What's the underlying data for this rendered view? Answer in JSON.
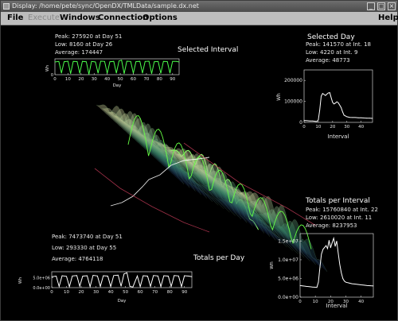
{
  "window": {
    "title": "Display: /home/pete/sync/OpenDX/TMLData/sample.dx.net"
  },
  "menu": {
    "file": "File",
    "execute": "Execute",
    "windows": "Windows",
    "connection": "Connection",
    "options": "Options",
    "help": "Help"
  },
  "selected_interval": {
    "title": "Selected Interval",
    "peak": "Peak: 275920 at Day 51",
    "low": "Low: 8160 at Day 26",
    "average": "Average: 174447",
    "ylabel": "Wh",
    "xlabel": "Day",
    "xticks": [
      "0",
      "10",
      "20",
      "30",
      "40",
      "50",
      "60",
      "70",
      "80",
      "90"
    ],
    "yticks": [
      "0"
    ]
  },
  "selected_day": {
    "title": "Selected Day",
    "peak": "Peak: 141570 at Int. 18",
    "low": "Low: 4220 at Int. 9",
    "average": "Average: 48773",
    "ylabel": "Wh",
    "xlabel": "Interval",
    "yticks": [
      "200000",
      "100000",
      "0"
    ],
    "xticks": [
      "0",
      "10",
      "20",
      "30",
      "40"
    ]
  },
  "totals_per_interval": {
    "title": "Totals per Interval",
    "peak": "Peak: 15760840 at Int. 22",
    "low": "Low: 2610020 at Int. 11",
    "average": "Average: 8237953",
    "ylabel": "Wh",
    "xlabel": "Interval",
    "yticks": [
      "1.5e+07",
      "1.0e+07",
      "5.0e+06",
      "0.0e+00"
    ],
    "xticks": [
      "0",
      "10",
      "20",
      "30",
      "40"
    ]
  },
  "totals_per_day": {
    "title": "Totals per Day",
    "peak": "Peak: 7473740 at Day 51",
    "low": "Low: 293330 at Day 55",
    "average": "Average: 4764118",
    "ylabel": "Wh",
    "xlabel": "Day",
    "yticks": [
      "5.0e+06",
      "0.0e+00"
    ],
    "xticks": [
      "0",
      "10",
      "20",
      "30",
      "40",
      "50",
      "60",
      "70",
      "80",
      "90"
    ]
  },
  "chart_data": [
    {
      "type": "line",
      "title": "Selected Day",
      "xlabel": "Interval",
      "ylabel": "Wh",
      "xlim": [
        0,
        48
      ],
      "ylim": [
        0,
        250000
      ],
      "x": [
        0,
        2,
        4,
        6,
        8,
        9,
        10,
        11,
        12,
        13,
        14,
        15,
        16,
        17,
        18,
        19,
        20,
        21,
        22,
        23,
        24,
        25,
        26,
        27,
        28,
        30,
        32,
        34,
        36,
        38,
        40,
        42,
        44,
        46,
        48
      ],
      "values": [
        9000,
        8000,
        7000,
        6500,
        5000,
        4220,
        12000,
        60000,
        125000,
        138000,
        133000,
        128000,
        135000,
        140000,
        141570,
        118000,
        96000,
        88000,
        92000,
        98000,
        93000,
        82000,
        70000,
        50000,
        34000,
        27000,
        24000,
        23000,
        23000,
        22000,
        22000,
        21000,
        20000,
        20000,
        19000
      ]
    },
    {
      "type": "line",
      "title": "Totals per Interval",
      "xlabel": "Interval",
      "ylabel": "Wh",
      "xlim": [
        0,
        48
      ],
      "ylim": [
        0,
        17000000
      ],
      "x": [
        0,
        2,
        4,
        6,
        8,
        10,
        11,
        12,
        13,
        14,
        15,
        16,
        17,
        18,
        19,
        20,
        21,
        22,
        23,
        24,
        25,
        26,
        27,
        28,
        29,
        30,
        32,
        34,
        36,
        38,
        40,
        42,
        44,
        46,
        48
      ],
      "values": [
        3100000,
        3000000,
        2900000,
        2800000,
        2700000,
        2650000,
        2610020,
        4000000,
        8000000,
        11500000,
        12800000,
        13300000,
        13800000,
        13000000,
        15200000,
        13200000,
        14600000,
        15760840,
        13600000,
        15000000,
        11800000,
        8800000,
        6500000,
        5000000,
        4300000,
        4000000,
        3800000,
        3600000,
        3500000,
        3400000,
        3300000,
        3200000,
        3100000,
        3050000,
        3000000
      ]
    },
    {
      "type": "line",
      "title": "Selected Interval",
      "xlabel": "Day",
      "ylabel": "Wh",
      "xlim": [
        0,
        95
      ],
      "x": [
        0,
        3,
        5,
        7,
        10,
        12,
        14,
        17,
        19,
        21,
        24,
        26,
        28,
        31,
        33,
        35,
        38,
        40,
        42,
        45,
        47,
        49,
        51,
        53,
        55,
        58,
        60,
        62,
        65,
        67,
        69,
        72,
        74,
        76,
        79,
        81,
        83,
        86,
        88,
        90,
        93,
        95
      ],
      "values": [
        240000,
        250000,
        30000,
        245000,
        255000,
        20000,
        250000,
        248000,
        25000,
        252000,
        245000,
        8160,
        250000,
        240000,
        30000,
        255000,
        250000,
        25000,
        245000,
        252000,
        30000,
        260000,
        275920,
        20000,
        255000,
        250000,
        25000,
        248000,
        252000,
        30000,
        250000,
        255000,
        20000,
        245000,
        250000,
        25000,
        250000,
        248000,
        30000,
        252000,
        250000,
        240000
      ]
    },
    {
      "type": "line",
      "title": "Totals per Day",
      "xlabel": "Day",
      "ylabel": "Wh",
      "xlim": [
        0,
        95
      ],
      "ylim": [
        0,
        8000000
      ],
      "x": [
        0,
        3,
        5,
        7,
        10,
        12,
        14,
        17,
        19,
        21,
        24,
        26,
        28,
        31,
        33,
        35,
        38,
        40,
        42,
        45,
        47,
        49,
        51,
        53,
        55,
        58,
        60,
        62,
        65,
        67,
        69,
        72,
        74,
        76,
        79,
        81,
        83,
        86,
        88,
        90,
        93,
        95
      ],
      "values": [
        5500000,
        5800000,
        600000,
        6000000,
        5700000,
        500000,
        5900000,
        6100000,
        700000,
        5800000,
        6000000,
        500000,
        6200000,
        5900000,
        600000,
        6000000,
        5800000,
        500000,
        6100000,
        6300000,
        700000,
        6900000,
        7473740,
        600000,
        293330,
        5900000,
        500000,
        6000000,
        5800000,
        600000,
        6100000,
        5900000,
        500000,
        6000000,
        5800000,
        600000,
        6100000,
        5900000,
        500000,
        6000000,
        5800000,
        5500000
      ]
    }
  ]
}
